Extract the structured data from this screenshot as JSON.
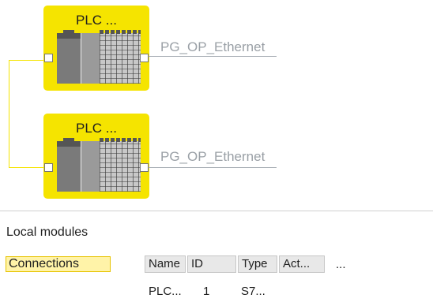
{
  "network": {
    "devices": [
      {
        "title": "PLC ...",
        "port_label": "PG_OP_Ethernet"
      },
      {
        "title": "PLC ...",
        "port_label": "PG_OP_Ethernet"
      }
    ]
  },
  "local_modules": {
    "title": "Local modules",
    "connections_label": "Connections",
    "columns": [
      "Name",
      "ID",
      "Type",
      "Act..."
    ],
    "more_label": "...",
    "rows": [
      {
        "name": "PLC...",
        "id": "1",
        "type": "S7..."
      }
    ]
  },
  "colors": {
    "device_fill": "#f5e400",
    "connection_line": "#f5e400",
    "ethernet_label": "#9aa0a6"
  }
}
